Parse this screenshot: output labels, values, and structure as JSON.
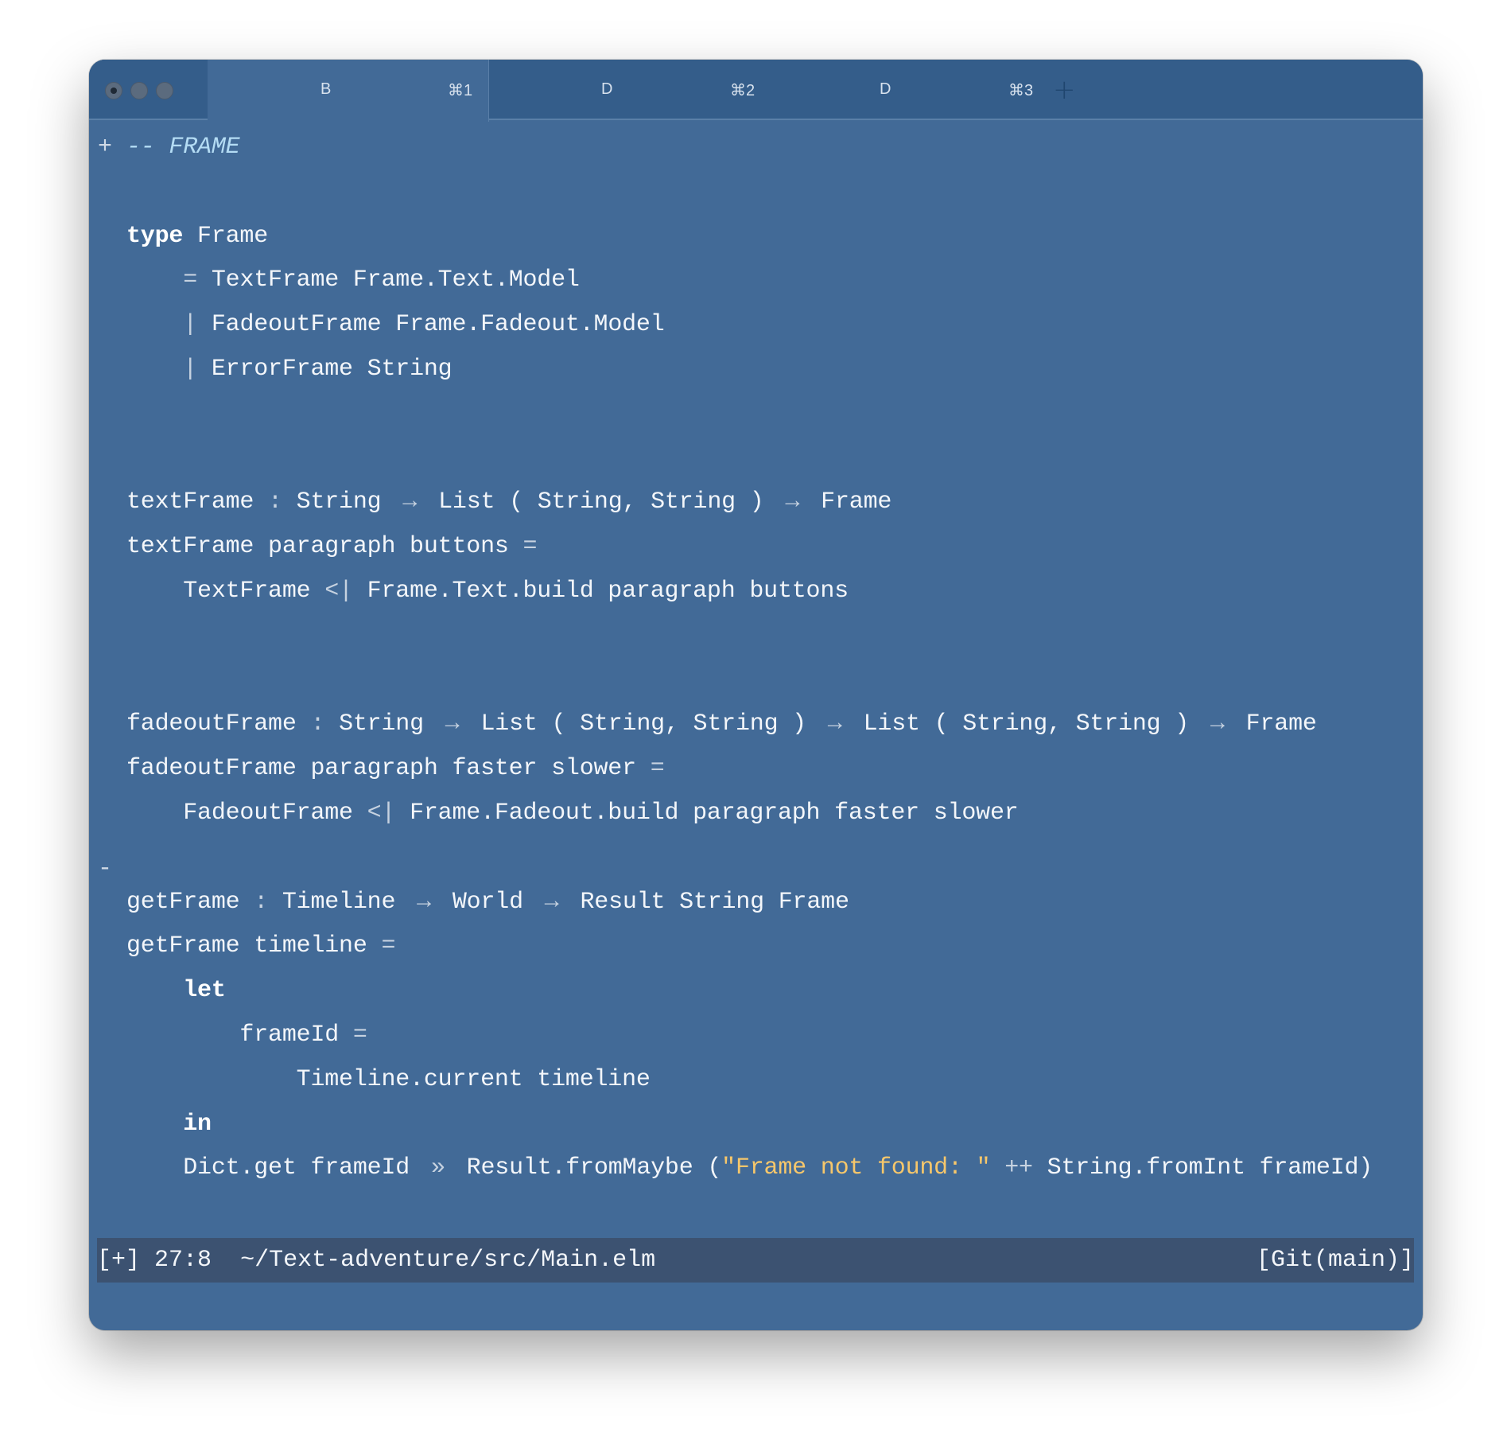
{
  "window": {
    "tabs": [
      {
        "label": "B",
        "shortcut": "⌘1",
        "active": true
      },
      {
        "label": "D",
        "shortcut": "⌘2",
        "active": false
      },
      {
        "label": "D",
        "shortcut": "⌘3",
        "active": false
      }
    ],
    "new_tab_icon": "plus-icon"
  },
  "editor": {
    "markers": {
      "added": "+",
      "removed": "-"
    },
    "lines": [
      [
        [
          "-- FRAME",
          "cm"
        ]
      ],
      [],
      [
        [
          "type",
          "kw"
        ],
        [
          " Frame",
          ""
        ]
      ],
      [
        [
          "    ",
          ""
        ],
        [
          "=",
          "op"
        ],
        [
          " TextFrame Frame.Text.Model",
          ""
        ]
      ],
      [
        [
          "    ",
          ""
        ],
        [
          "|",
          "op"
        ],
        [
          " FadeoutFrame Frame.Fadeout.Model",
          ""
        ]
      ],
      [
        [
          "    ",
          ""
        ],
        [
          "|",
          "op"
        ],
        [
          " ErrorFrame String",
          ""
        ]
      ],
      [],
      [],
      [
        [
          "textFrame ",
          ""
        ],
        [
          ":",
          "op"
        ],
        [
          " String ",
          ""
        ],
        [
          "→",
          "op w2"
        ],
        [
          " List ( String, String ) ",
          ""
        ],
        [
          "→",
          "op w2"
        ],
        [
          " Frame",
          ""
        ]
      ],
      [
        [
          "textFrame paragraph buttons ",
          ""
        ],
        [
          "=",
          "op"
        ]
      ],
      [
        [
          "    TextFrame ",
          ""
        ],
        [
          "<|",
          "op"
        ],
        [
          " Frame.Text.build paragraph buttons",
          ""
        ]
      ],
      [],
      [],
      [
        [
          "fadeoutFrame ",
          ""
        ],
        [
          ":",
          "op"
        ],
        [
          " String ",
          ""
        ],
        [
          "→",
          "op w2"
        ],
        [
          " List ( String, String ) ",
          ""
        ],
        [
          "→",
          "op w2"
        ],
        [
          " List ( String, String ) ",
          ""
        ],
        [
          "→",
          "op w2"
        ],
        [
          " Frame",
          ""
        ]
      ],
      [
        [
          "fadeoutFrame paragraph faster slower ",
          ""
        ],
        [
          "=",
          "op"
        ]
      ],
      [
        [
          "    FadeoutFrame ",
          ""
        ],
        [
          "<|",
          "op"
        ],
        [
          " Frame.Fadeout.build paragraph faster slower",
          ""
        ]
      ],
      [],
      [
        [
          "getFrame ",
          ""
        ],
        [
          ":",
          "op"
        ],
        [
          " Timeline ",
          ""
        ],
        [
          "→",
          "op w2"
        ],
        [
          " World ",
          ""
        ],
        [
          "→",
          "op w2"
        ],
        [
          " Result String Frame",
          ""
        ]
      ],
      [
        [
          "getFrame timeline ",
          ""
        ],
        [
          "=",
          "op"
        ]
      ],
      [
        [
          "    ",
          ""
        ],
        [
          "let",
          "kw"
        ]
      ],
      [
        [
          "        frameId ",
          ""
        ],
        [
          "=",
          "op"
        ]
      ],
      [
        [
          "            Timeline.current timeline",
          ""
        ]
      ],
      [
        [
          "    ",
          ""
        ],
        [
          "in",
          "kw"
        ]
      ],
      [
        [
          "    Dict.get frameId ",
          ""
        ],
        [
          "»",
          "op w2"
        ],
        [
          " Result.fromMaybe (",
          ""
        ],
        [
          "\"Frame not found: \"",
          "str"
        ],
        [
          " ",
          ""
        ],
        [
          "++",
          "op"
        ],
        [
          " String.fromInt frameId)",
          ""
        ]
      ]
    ]
  },
  "statusbar": {
    "modified": "[+]",
    "position": "27:8",
    "path": "~/Text-adventure/src/Main.elm",
    "git": "[Git(main)]"
  },
  "colors": {
    "background": "#426a97",
    "tabbar": "#345d8a",
    "statusbar": "#3c5271",
    "string": "#f6c76b",
    "comment": "#b4dcf4"
  }
}
